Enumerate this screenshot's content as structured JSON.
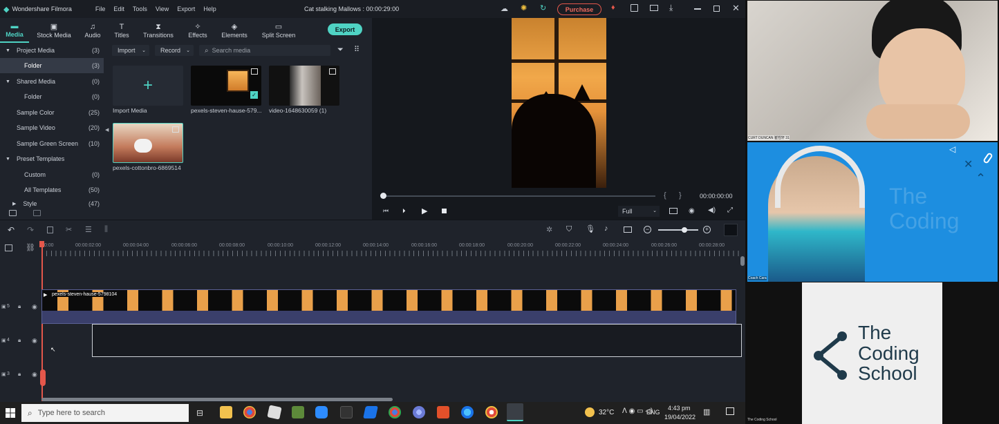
{
  "app": {
    "name": "Wondershare Filmora",
    "project_title": "Cat stalking Mallows : 00:00:29:00",
    "purchase_label": "Purchase"
  },
  "menu": [
    "File",
    "Edit",
    "Tools",
    "View",
    "Export",
    "Help"
  ],
  "toolbar": {
    "tabs": [
      {
        "label": "Media",
        "icon": "folder-icon"
      },
      {
        "label": "Stock Media",
        "icon": "camera-icon"
      },
      {
        "label": "Audio",
        "icon": "music-note-icon"
      },
      {
        "label": "Titles",
        "icon": "text-t-icon"
      },
      {
        "label": "Transitions",
        "icon": "transition-icon"
      },
      {
        "label": "Effects",
        "icon": "effects-icon"
      },
      {
        "label": "Elements",
        "icon": "elements-icon"
      },
      {
        "label": "Split Screen",
        "icon": "split-screen-icon"
      }
    ],
    "export_label": "Export"
  },
  "sidebar": {
    "items": [
      {
        "label": "Project Media",
        "count": "(3)"
      },
      {
        "label": "Folder",
        "count": "(3)"
      },
      {
        "label": "Shared Media",
        "count": "(0)"
      },
      {
        "label": "Folder",
        "count": "(0)"
      },
      {
        "label": "Sample Color",
        "count": "(25)"
      },
      {
        "label": "Sample Video",
        "count": "(20)"
      },
      {
        "label": "Sample Green Screen",
        "count": "(10)"
      },
      {
        "label": "Preset Templates",
        "count": ""
      },
      {
        "label": "Custom",
        "count": "(0)"
      },
      {
        "label": "All Templates",
        "count": "(50)"
      },
      {
        "label": "Style",
        "count": "(47)"
      }
    ]
  },
  "media": {
    "import_label": "Import",
    "record_label": "Record",
    "search_placeholder": "Search media",
    "items": [
      {
        "label": "Import Media"
      },
      {
        "label": "pexels-steven-hause-579..."
      },
      {
        "label": "video-1648630059 (1)"
      },
      {
        "label": "pexels-cottonbro-6869514"
      }
    ]
  },
  "preview": {
    "timecode": "00:00:00:00",
    "quality": "Full",
    "bracket_left": "{",
    "bracket_right": "}"
  },
  "timeline": {
    "ticks": [
      "00:00",
      "00:00:02:00",
      "00:00:04:00",
      "00:00:06:00",
      "00:00:08:00",
      "00:00:10:00",
      "00:00:12:00",
      "00:00:14:00",
      "00:00:16:00",
      "00:00:18:00",
      "00:00:20:00",
      "00:00:22:00",
      "00:00:24:00",
      "00:00:26:00",
      "00:00:28:00"
    ],
    "clip_label": "pexels-steven-hause-5798104",
    "tracks": [
      "5",
      "4",
      "3"
    ]
  },
  "taskbar": {
    "search_placeholder": "Type here to search",
    "temperature": "32°C",
    "language": "ENG",
    "time": "4:43 pm",
    "date": "19/04/2022"
  },
  "video_call": {
    "participants": [
      {
        "name": "CURT DUNCAN 崔性轩 31"
      },
      {
        "name": "Coach Cara"
      },
      {
        "name": "The Coding School"
      }
    ],
    "watermark": "The Coding",
    "logo_lines": [
      "The",
      "Coding",
      "School"
    ]
  },
  "colors": {
    "accent": "#4fd3c4",
    "purchase": "#e4574b",
    "zoom_blue": "#1d8ee0"
  }
}
